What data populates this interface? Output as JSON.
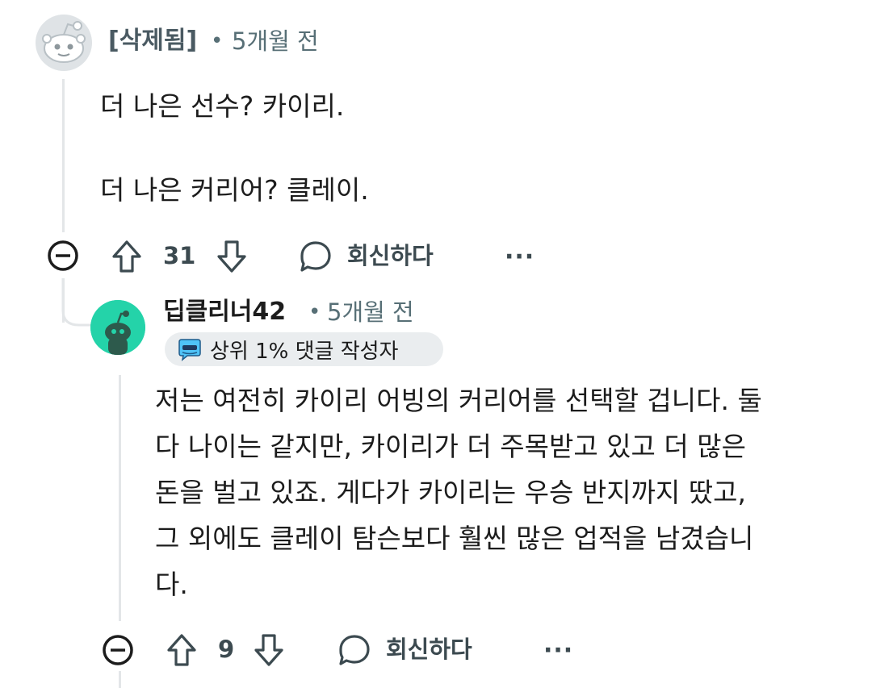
{
  "comments": [
    {
      "username": "[삭제됨]",
      "separator": "•",
      "time": "5개월 전",
      "avatar_icon": "deleted-user-snoo-icon",
      "body": "더 나은 선수? 카이리.\n\n더 나은 커리어? 클레이.",
      "actions": {
        "collapse_icon": "collapse-icon",
        "upvote_icon": "upvote-icon",
        "score": "31",
        "downvote_icon": "downvote-icon",
        "reply_icon": "reply-icon",
        "reply_label": "회신하다",
        "more": "···"
      }
    },
    {
      "username": "딥클리너42",
      "separator": "•",
      "time": "5개월 전",
      "avatar_icon": "snoo-avatar-icon",
      "avatar_color": "#24d3a9",
      "flair": {
        "icon": "top-commenter-badge-icon",
        "label": "상위 1% 댓글 작성자"
      },
      "body_lines": [
        "저는 여전히 카이리 어빙의 커리어를 선택할 겁니다. 둘",
        "다 나이는 같지만, 카이리가 더 주목받고 있고 더 많은",
        "돈을 벌고 있죠. 게다가 카이리는 우승 반지까지 땄고,",
        "그 외에도 클레이 탐슨보다 훨씬 많은 업적을 남겼습니",
        "다."
      ],
      "actions": {
        "collapse_icon": "collapse-icon",
        "upvote_icon": "upvote-icon",
        "score": "9",
        "downvote_icon": "downvote-icon",
        "reply_icon": "reply-icon",
        "reply_label": "회신하다",
        "more": "···"
      }
    }
  ],
  "colors": {
    "text": "#1c1c1c",
    "meta": "#576f76",
    "action": "#3c4a50",
    "thread_line": "#e3e6e8",
    "flair_bg": "#eaedef"
  }
}
